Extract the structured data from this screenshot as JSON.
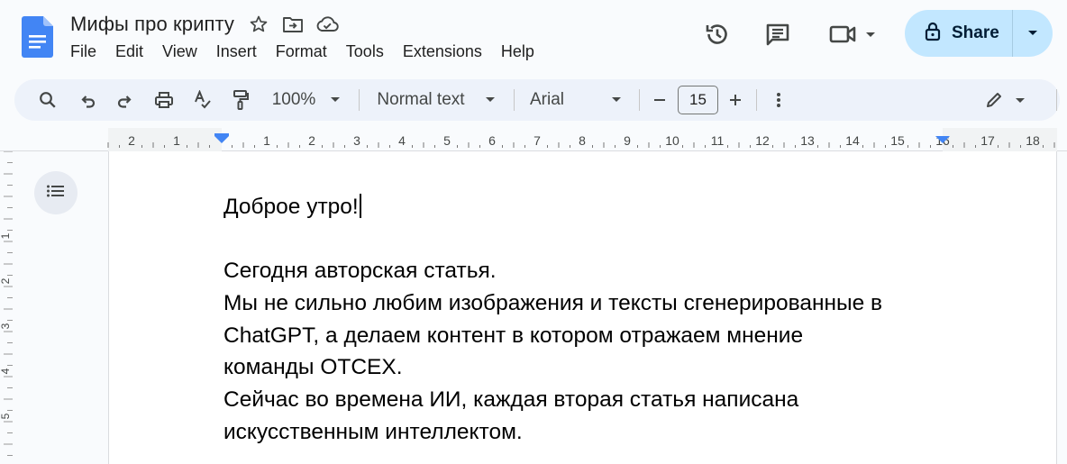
{
  "header": {
    "doc_title": "Мифы про крипту",
    "menu": [
      "File",
      "Edit",
      "View",
      "Insert",
      "Format",
      "Tools",
      "Extensions",
      "Help"
    ],
    "share_label": "Share"
  },
  "toolbar": {
    "zoom": "100%",
    "style": "Normal text",
    "font": "Arial",
    "font_size": "15"
  },
  "ruler": {
    "labels": [
      "2",
      "1",
      "1",
      "2",
      "3",
      "4",
      "5",
      "6",
      "7",
      "8",
      "9",
      "10",
      "11",
      "12",
      "13",
      "14",
      "15",
      "16",
      "17",
      "18"
    ],
    "vlabels": [
      "1",
      "2",
      "3",
      "4",
      "5"
    ]
  },
  "document": {
    "lines": [
      "Доброе утро!",
      "",
      "Сегодня авторская статья.",
      "Мы не сильно любим изображения и тексты сгенерированные в",
      "ChatGPT, а делаем контент в котором отражаем мнение",
      "команды OTCEX.",
      "Сейчас во времена ИИ, каждая вторая статья написана",
      "искусственным интеллектом."
    ]
  },
  "colors": {
    "accent": "#c2e7ff",
    "toolbar_bg": "#edf2fa",
    "doc_icon": "#4285f4",
    "ruler_marker": "#4285f4"
  },
  "icons": [
    "docs-logo-icon",
    "star-icon",
    "move-to-folder-icon",
    "cloud-saved-icon",
    "version-history-icon",
    "comments-icon",
    "meet-video-icon",
    "lock-icon",
    "search-icon",
    "undo-icon",
    "redo-icon",
    "print-icon",
    "spellcheck-icon",
    "paint-format-icon",
    "minus-icon",
    "plus-icon",
    "more-vert-icon",
    "edit-mode-pencil-icon",
    "outline-list-icon"
  ]
}
